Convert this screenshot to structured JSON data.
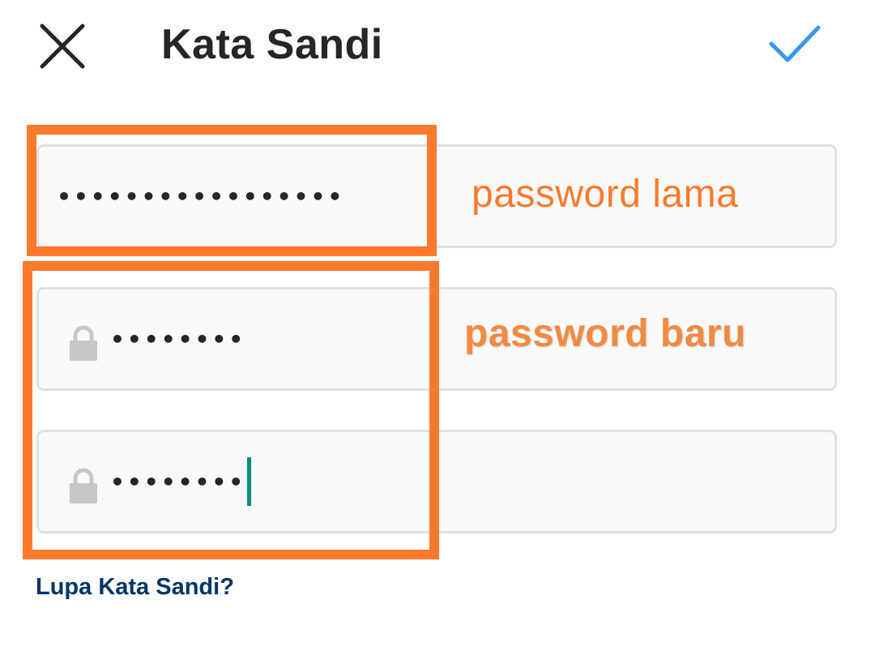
{
  "header": {
    "title": "Kata Sandi",
    "close_icon": "close-icon",
    "done_icon": "checkmark-icon",
    "accent_color": "#3897f0"
  },
  "fields": {
    "current_password": {
      "masked_value": "•••••••••••••••••"
    },
    "new_password": {
      "masked_value": "••••••••",
      "icon": "lock-icon"
    },
    "confirm_password": {
      "masked_value": "••••••••",
      "icon": "lock-icon",
      "focused": true
    }
  },
  "annotations": {
    "old_password_label": "password lama",
    "new_password_label": "password baru",
    "color": "#fd7a2c"
  },
  "links": {
    "forgot_password": "Lupa Kata Sandi?"
  }
}
